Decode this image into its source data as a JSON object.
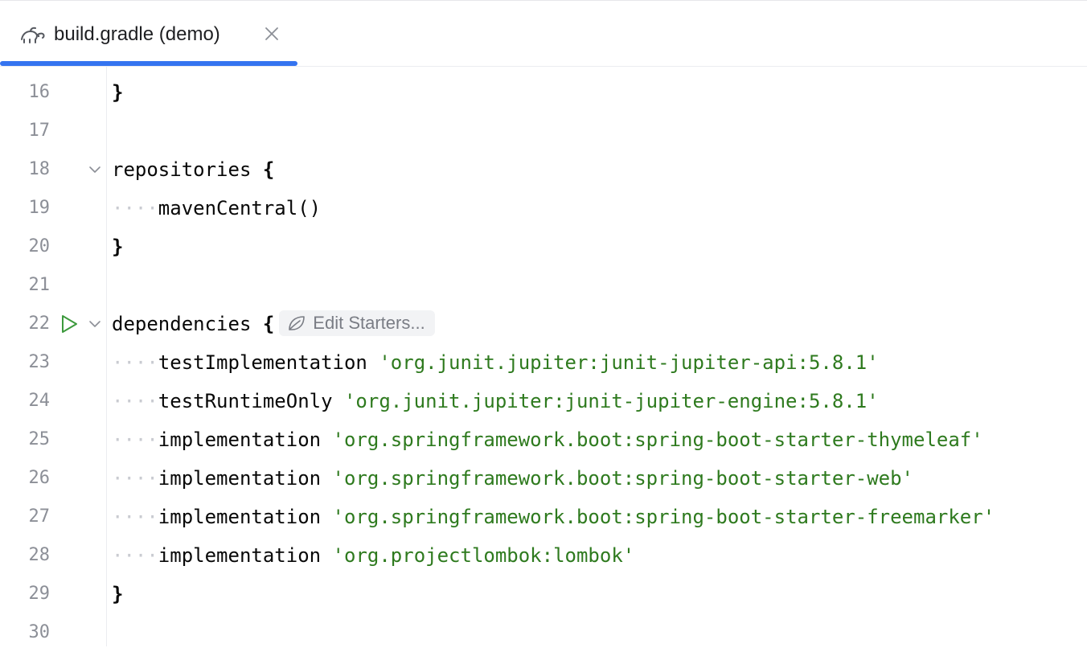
{
  "tab": {
    "label": "build.gradle (demo)",
    "icon": "gradle-elephant-icon",
    "close_icon": "close-icon"
  },
  "colors": {
    "accent": "#3574f0",
    "string": "#2e7a1e",
    "line_number": "#8c8f97",
    "run_icon": "#3d9a3d"
  },
  "editor": {
    "lines": [
      {
        "num": "16",
        "indent": "",
        "text": "",
        "tail": "}",
        "str": ""
      },
      {
        "num": "17",
        "indent": "",
        "text": "",
        "tail": "",
        "str": ""
      },
      {
        "num": "18",
        "indent": "",
        "text": "repositories ",
        "tail": "{",
        "str": ""
      },
      {
        "num": "19",
        "indent": "····",
        "text": "mavenCentral()",
        "tail": "",
        "str": ""
      },
      {
        "num": "20",
        "indent": "",
        "text": "",
        "tail": "}",
        "str": ""
      },
      {
        "num": "21",
        "indent": "",
        "text": "",
        "tail": "",
        "str": ""
      },
      {
        "num": "22",
        "indent": "",
        "text": "dependencies ",
        "tail": "{",
        "str": ""
      },
      {
        "num": "23",
        "indent": "····",
        "text": "testImplementation ",
        "tail": "",
        "str": "'org.junit.jupiter:junit-jupiter-api:5.8.1'"
      },
      {
        "num": "24",
        "indent": "····",
        "text": "testRuntimeOnly ",
        "tail": "",
        "str": "'org.junit.jupiter:junit-jupiter-engine:5.8.1'"
      },
      {
        "num": "25",
        "indent": "····",
        "text": "implementation ",
        "tail": "",
        "str": "'org.springframework.boot:spring-boot-starter-thymeleaf'"
      },
      {
        "num": "26",
        "indent": "····",
        "text": "implementation ",
        "tail": "",
        "str": "'org.springframework.boot:spring-boot-starter-web'"
      },
      {
        "num": "27",
        "indent": "····",
        "text": "implementation ",
        "tail": "",
        "str": "'org.springframework.boot:spring-boot-starter-freemarker'"
      },
      {
        "num": "28",
        "indent": "····",
        "text": "implementation ",
        "tail": "",
        "str": "'org.projectlombok:lombok'"
      },
      {
        "num": "29",
        "indent": "",
        "text": "",
        "tail": "}",
        "str": ""
      },
      {
        "num": "30",
        "indent": "",
        "text": "",
        "tail": "",
        "str": ""
      }
    ],
    "inlay_hint": {
      "label": "Edit Starters...",
      "icon": "spring-leaf-icon"
    }
  }
}
